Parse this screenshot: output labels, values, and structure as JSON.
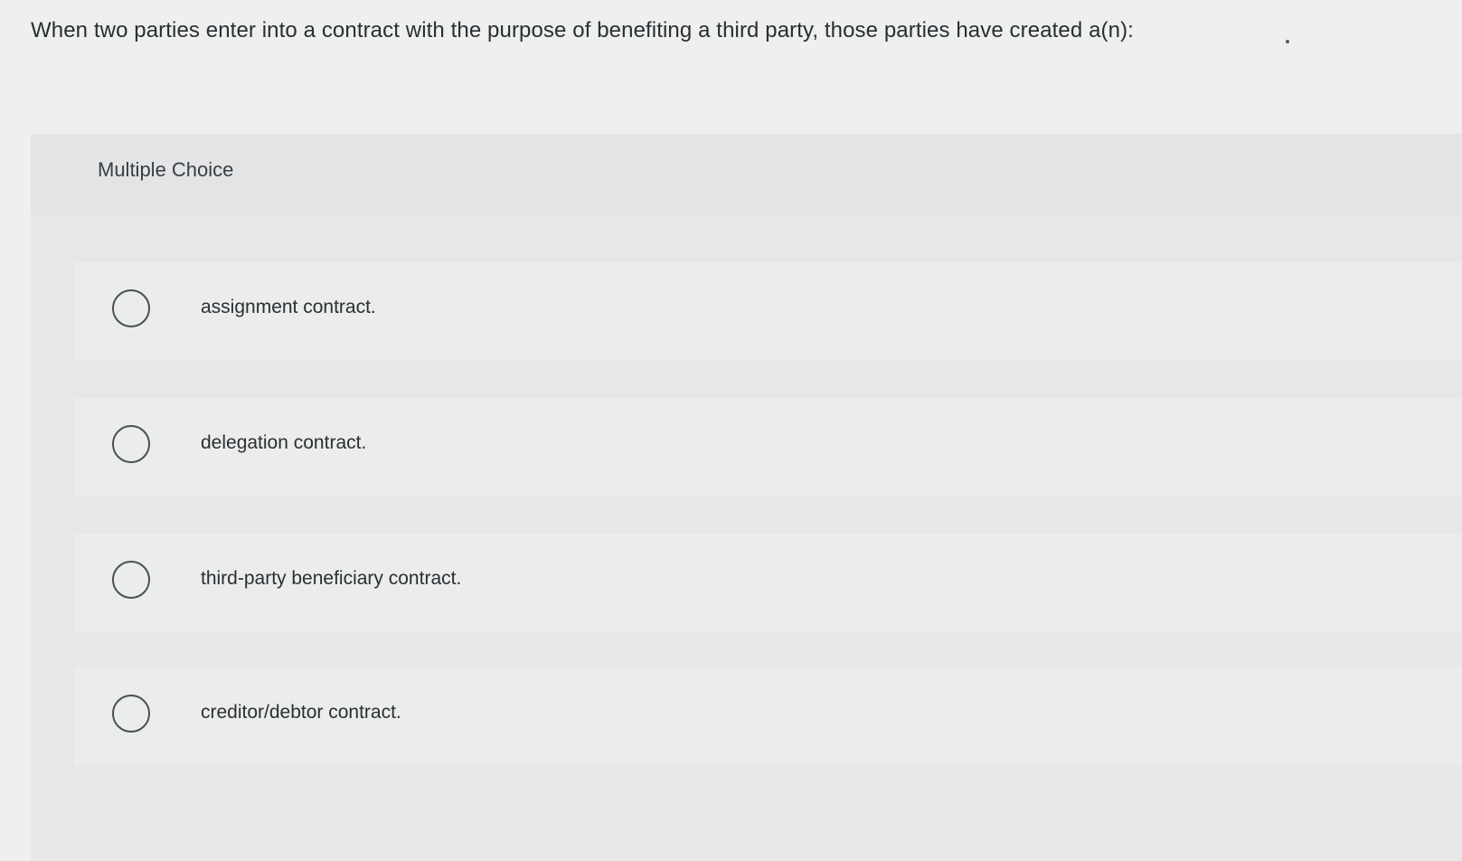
{
  "question": {
    "text": "When two parties enter into a contract with the purpose of benefiting a third party, those parties have created a(n):"
  },
  "panel": {
    "title": "Multiple Choice"
  },
  "options": [
    {
      "label": "assignment contract.",
      "selected": false
    },
    {
      "label": "delegation contract.",
      "selected": false
    },
    {
      "label": "third-party beneficiary contract.",
      "selected": false
    },
    {
      "label": "creditor/debtor contract.",
      "selected": false
    }
  ]
}
